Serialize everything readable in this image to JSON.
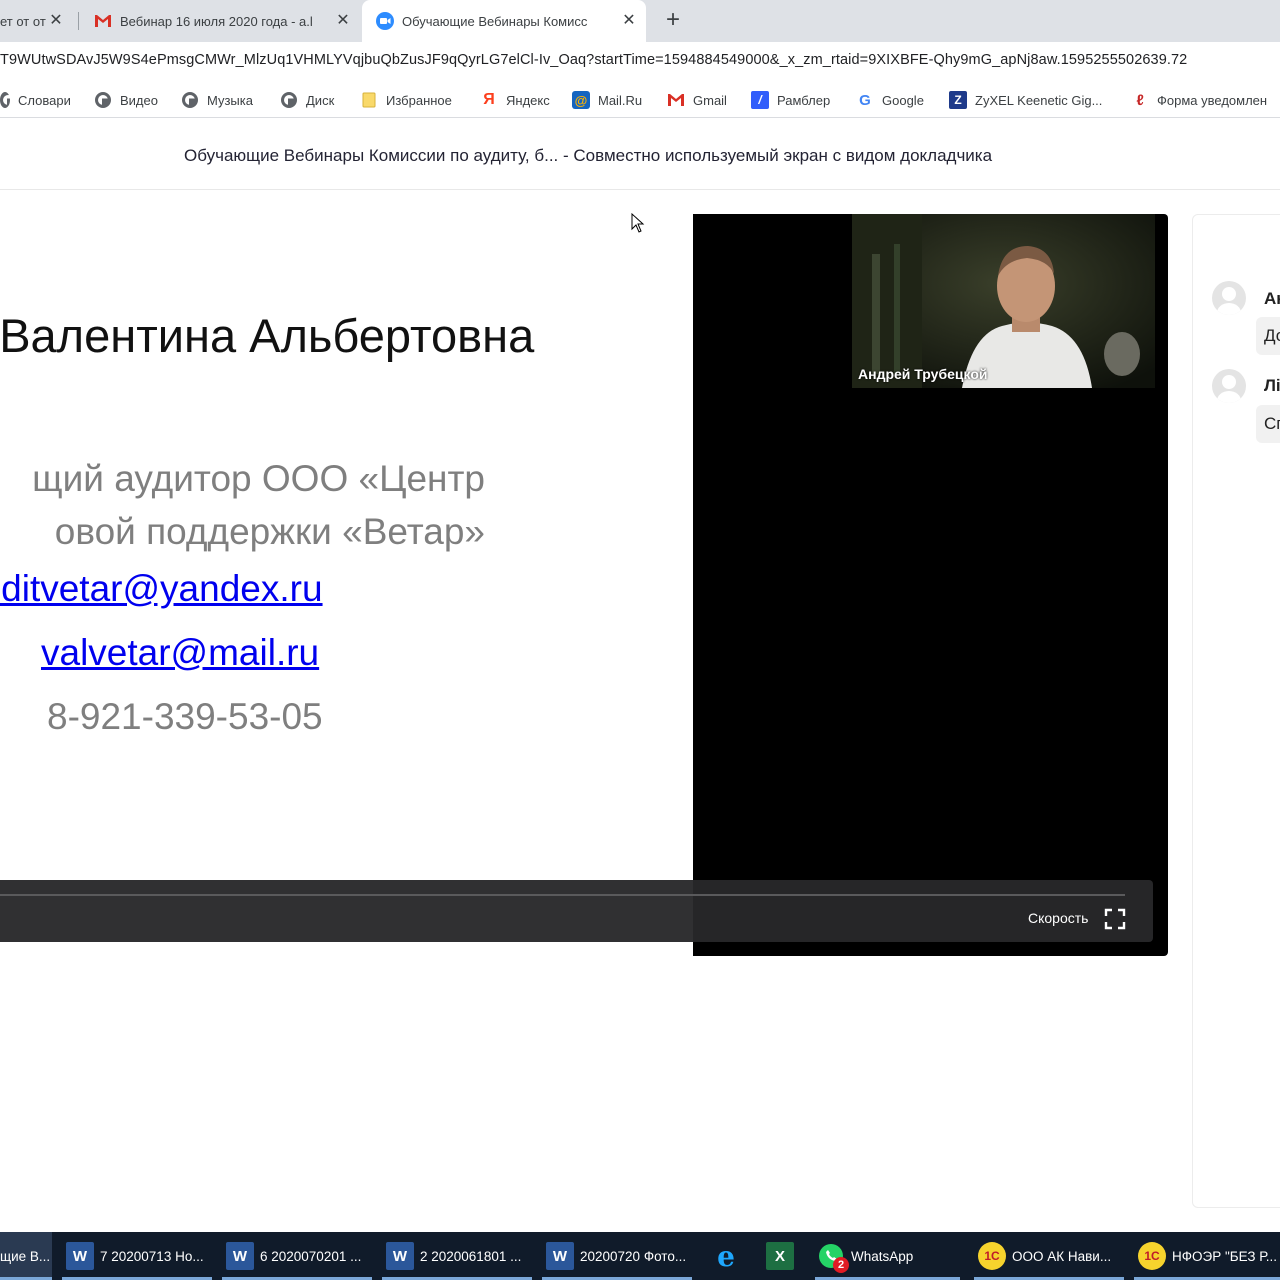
{
  "tabs": [
    {
      "title": "ет от от",
      "icon": "page-icon"
    },
    {
      "title": "Вебинар 16 июля 2020 года - a.l",
      "icon": "gmail-icon"
    },
    {
      "title": "Обучающие Вебинары Комисс",
      "icon": "zoom-icon",
      "active": true
    }
  ],
  "url": "T9WUtwSDAvJ5W9S4ePmsgCMWr_MlzUq1VHMLYVqjbuQbZusJF9qQyrLG7elCl-Iv_Oaq?startTime=1594884549000&_x_zm_rtaid=9XIXBFE-Qhy9mG_apNj8aw.1595255502639.72",
  "bookmarks": [
    {
      "label": "Словари",
      "icon": "globe-icon"
    },
    {
      "label": "Видео",
      "icon": "globe-icon"
    },
    {
      "label": "Музыка",
      "icon": "globe-icon"
    },
    {
      "label": "Диск",
      "icon": "globe-icon"
    },
    {
      "label": "Избранное",
      "icon": "folder-icon"
    },
    {
      "label": "Яндекс",
      "icon": "yandex-icon"
    },
    {
      "label": "Mail.Ru",
      "icon": "mailru-icon"
    },
    {
      "label": "Gmail",
      "icon": "gmail-icon"
    },
    {
      "label": "Рамблер",
      "icon": "rambler-icon"
    },
    {
      "label": "Google",
      "icon": "google-icon"
    },
    {
      "label": "ZyXEL Keenetic Gig...",
      "icon": "zyxel-icon"
    },
    {
      "label": "Форма уведомлен",
      "icon": "form-icon"
    }
  ],
  "recording": {
    "title": "Обучающие Вебинары Комиссии по аудиту, б...  - Совместно используемый экран с видом докладчика"
  },
  "slide": {
    "name": "а Валентина Альбертовна",
    "role_line1": "щий аудитор ООО «Центр",
    "role_line2": "овой поддержки «Ветар»",
    "email1": "auditvetar@yandex.ru",
    "email2": "valvetar@mail.ru",
    "phone": "8-921-339-53-05"
  },
  "speaker": {
    "name": "Андрей Трубецкой"
  },
  "player": {
    "speed_label": "Скорость"
  },
  "chat": [
    {
      "name": "Ан",
      "text": "До"
    },
    {
      "name": "Лі",
      "text": "Сп"
    }
  ],
  "taskbar": [
    {
      "label": "щие В...",
      "icon": "zoom-icon"
    },
    {
      "label": "7 20200713 Но...",
      "icon": "word-icon"
    },
    {
      "label": "6 2020070201 ...",
      "icon": "word-icon"
    },
    {
      "label": "2 2020061801 ...",
      "icon": "word-icon"
    },
    {
      "label": "20200720 Фото...",
      "icon": "word-icon"
    },
    {
      "label": "",
      "icon": "ie-icon"
    },
    {
      "label": "",
      "icon": "excel-icon"
    },
    {
      "label": "WhatsApp",
      "icon": "whatsapp-icon",
      "badge": "2"
    },
    {
      "label": "ООО АК Нави...",
      "icon": "1c-icon"
    },
    {
      "label": "НФОЭР \"БЕЗ Р...",
      "icon": "1c-icon"
    }
  ],
  "colors": {
    "link": "#0000ee",
    "slide_grey": "#7f7f7f",
    "taskbar": "#101b2a",
    "player_bar": "#28282a"
  }
}
